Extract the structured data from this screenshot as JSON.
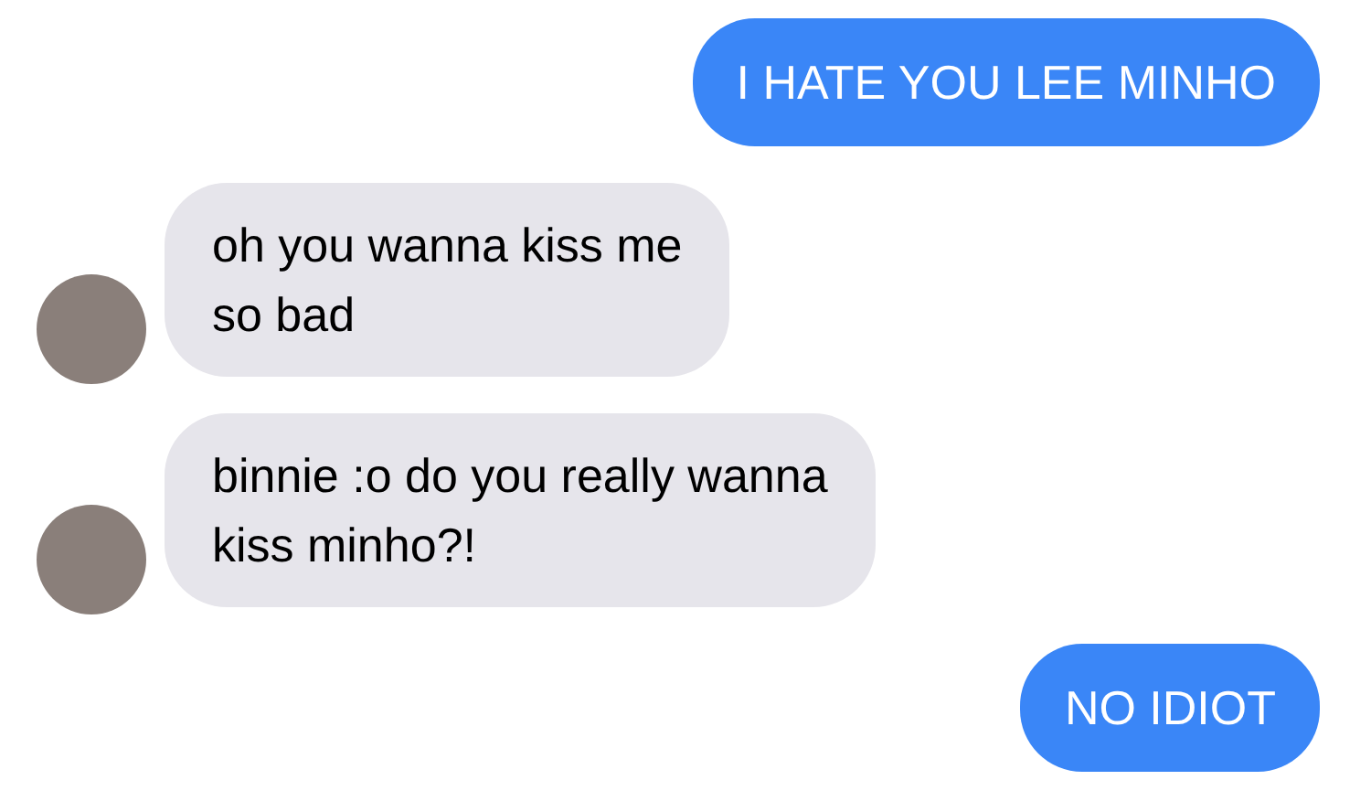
{
  "messages": [
    {
      "kind": "sent",
      "text": "I HATE YOU LEE MINHO"
    },
    {
      "kind": "received",
      "text": "oh you wanna kiss me\nso bad"
    },
    {
      "kind": "received",
      "text": "binnie :o do you really wanna\nkiss minho?!"
    },
    {
      "kind": "sent",
      "text": "NO IDIOT"
    }
  ]
}
